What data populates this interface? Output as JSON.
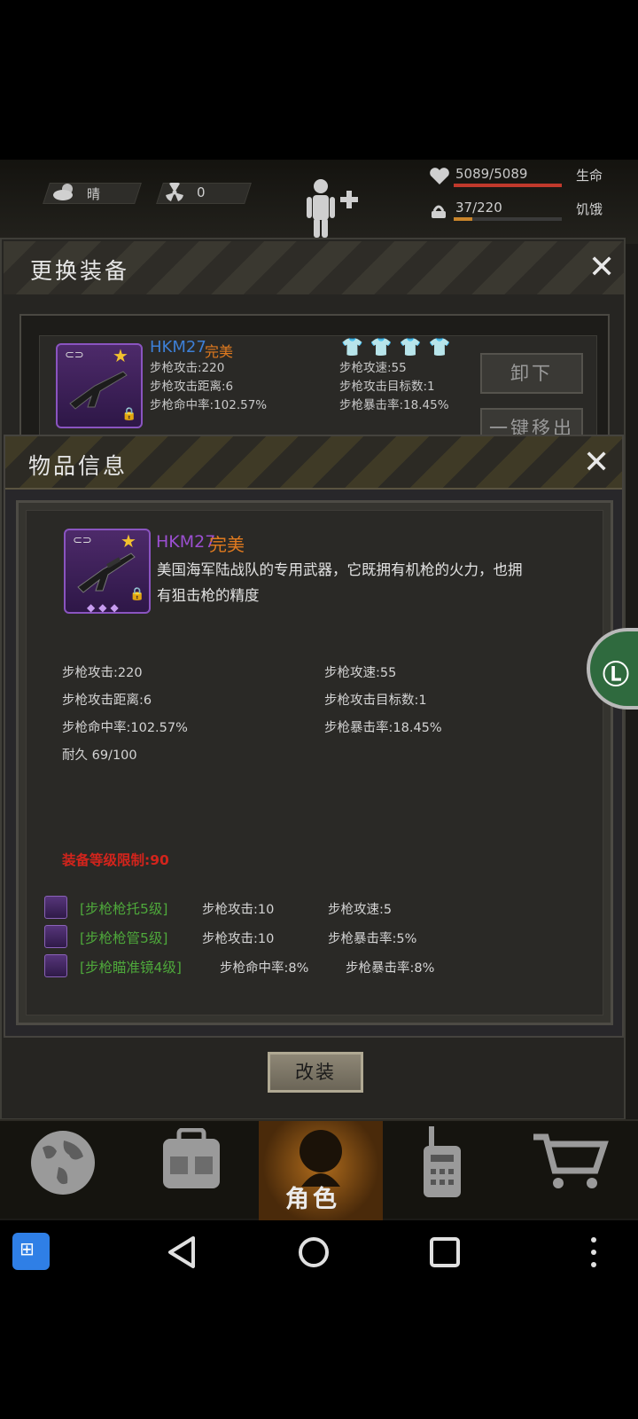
{
  "status": {
    "weather": "晴",
    "radiation": "0",
    "health": {
      "value": "5089/5089",
      "label": "生命",
      "fraction": 1.0,
      "color": "#c0392b"
    },
    "hunger": {
      "value": "37/220",
      "label": "饥饿",
      "fraction": 0.17,
      "color": "#c9842b"
    }
  },
  "equip_panel": {
    "title": "更换装备",
    "item": {
      "name": "HKM27",
      "quality": "完美",
      "stats_left": [
        "步枪攻击:220",
        "步枪攻击距离:6",
        "步枪命中率:102.57%"
      ],
      "stats_right": [
        "步枪攻速:55",
        "步枪攻击目标数:1",
        "步枪暴击率:18.45%"
      ]
    },
    "unequip_label": "卸下",
    "remove_all_label": "一键移出"
  },
  "item_info": {
    "title": "物品信息",
    "name": "HKM27",
    "quality": "完美",
    "description_line1": "美国海军陆战队的专用武器，它既拥有机枪的火力，也拥",
    "description_line2": "有狙击枪的精度",
    "stats_left": [
      "步枪攻击:220",
      "步枪攻击距离:6",
      "步枪命中率:102.57%",
      "耐久 69/100"
    ],
    "stats_right": [
      "步枪攻速:55",
      "步枪攻击目标数:1",
      "步枪暴击率:18.45%"
    ],
    "level_requirement": "装备等级限制:90",
    "mods": [
      {
        "name": "[步枪枪托5级]",
        "stat1": "步枪攻击:10",
        "stat2": "步枪攻速:5"
      },
      {
        "name": "[步枪枪管5级]",
        "stat1": "步枪攻击:10",
        "stat2": "步枪暴击率:5%"
      },
      {
        "name": "[步枪瞄准镜4级]",
        "stat1": "步枪命中率:8%",
        "stat2": "步枪暴击率:8%"
      }
    ],
    "modify_label": "改装"
  },
  "bottom_nav": {
    "active_label": "角色",
    "items": [
      "globe-icon",
      "backpack-icon",
      "character-icon",
      "radio-icon",
      "cart-icon"
    ]
  },
  "colors": {
    "quality": "#e07a1f",
    "item_name": "#9b4fd0",
    "equip_name": "#3d7fd6",
    "requirement": "#d2241c",
    "mod_green": "#4ea83b"
  }
}
